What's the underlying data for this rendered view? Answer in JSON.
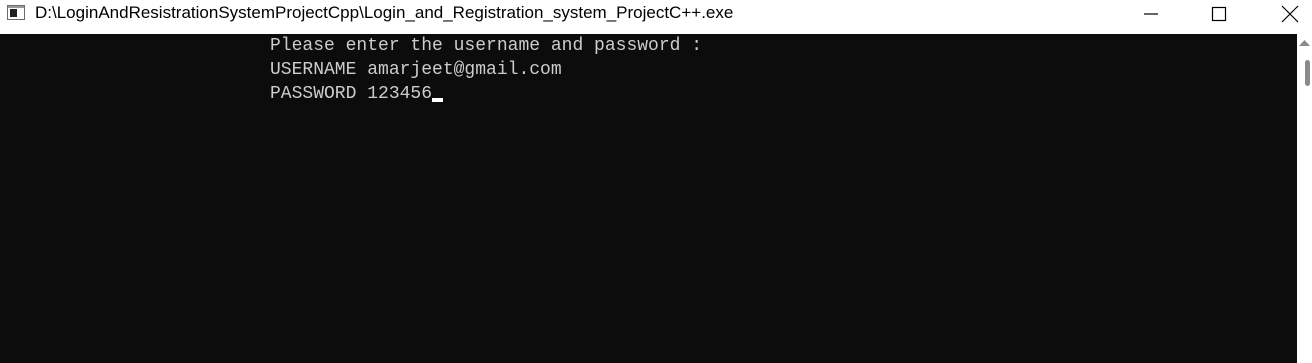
{
  "window": {
    "title": "D:\\LoginAndResistrationSystemProjectCpp\\Login_and_Registration_system_ProjectC++.exe",
    "icon": "console-app-icon"
  },
  "controls": {
    "minimize_icon": "minimize-icon",
    "maximize_icon": "maximize-icon",
    "close_icon": "close-icon"
  },
  "console": {
    "lines": [
      "Please enter the username and password :",
      "USERNAME amarjeet@gmail.com",
      "PASSWORD 123456"
    ],
    "background": "#0c0c0c",
    "foreground": "#cccccc"
  }
}
